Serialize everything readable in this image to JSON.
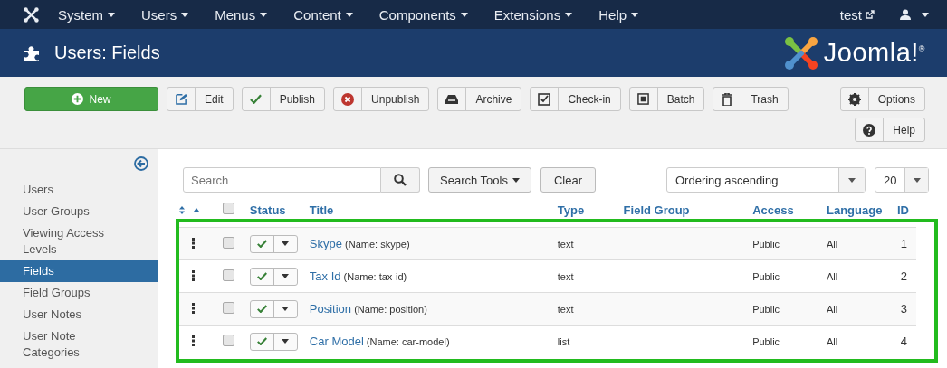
{
  "navbar": {
    "menus": [
      "System",
      "Users",
      "Menus",
      "Content",
      "Components",
      "Extensions",
      "Help"
    ],
    "site_link": "test"
  },
  "header": {
    "title": "Users: Fields",
    "logo_text": "Joomla!$^{®}$"
  },
  "toolbar": {
    "buttons": [
      {
        "kind": "new",
        "label": "New"
      },
      {
        "kind": "edit",
        "label": "Edit"
      },
      {
        "kind": "publish",
        "label": "Publish"
      },
      {
        "kind": "unpublish",
        "label": "Unpublish"
      },
      {
        "kind": "archive",
        "label": "Archive"
      },
      {
        "kind": "checkin",
        "label": "Check-in"
      },
      {
        "kind": "batch",
        "label": "Batch"
      },
      {
        "kind": "trash",
        "label": "Trash"
      }
    ],
    "right_buttons": [
      {
        "kind": "options",
        "label": "Options"
      },
      {
        "kind": "help",
        "label": "Help"
      }
    ]
  },
  "sidebar": {
    "items": [
      {
        "label": "Users",
        "selected": false
      },
      {
        "label": "User Groups",
        "selected": false
      },
      {
        "label": "Viewing Access Levels",
        "selected": false
      },
      {
        "label": "Fields",
        "selected": true
      },
      {
        "label": "Field Groups",
        "selected": false
      },
      {
        "label": "User Notes",
        "selected": false
      },
      {
        "label": "User Note Categories",
        "selected": false
      }
    ]
  },
  "filters": {
    "search": {
      "placeholder": "Search"
    },
    "search_tools": "Search Tools",
    "clear": "Clear",
    "ordering": "Ordering ascending",
    "limit": "20"
  },
  "table": {
    "highlighted": true,
    "select_all_checked": false,
    "columns": [
      "Status",
      "Title",
      "Type",
      "Field Group",
      "Access",
      "Language",
      "ID"
    ],
    "rows": [
      {
        "checked": false,
        "published": true,
        "title": "Skype",
        "name": "(Name: skype)",
        "type": "text",
        "access": "Public",
        "language": "All",
        "id": "1"
      },
      {
        "checked": false,
        "published": true,
        "title": "Tax Id",
        "name": "(Name: tax-id)",
        "type": "text",
        "access": "Public",
        "language": "All",
        "id": "2"
      },
      {
        "checked": false,
        "published": true,
        "title": "Position",
        "name": "(Name: position)",
        "type": "text",
        "access": "Public",
        "language": "All",
        "id": "3"
      },
      {
        "checked": false,
        "published": true,
        "title": "Car Model",
        "name": "(Name: car-model)",
        "type": "list",
        "access": "Public",
        "language": "All",
        "id": "4"
      }
    ]
  }
}
